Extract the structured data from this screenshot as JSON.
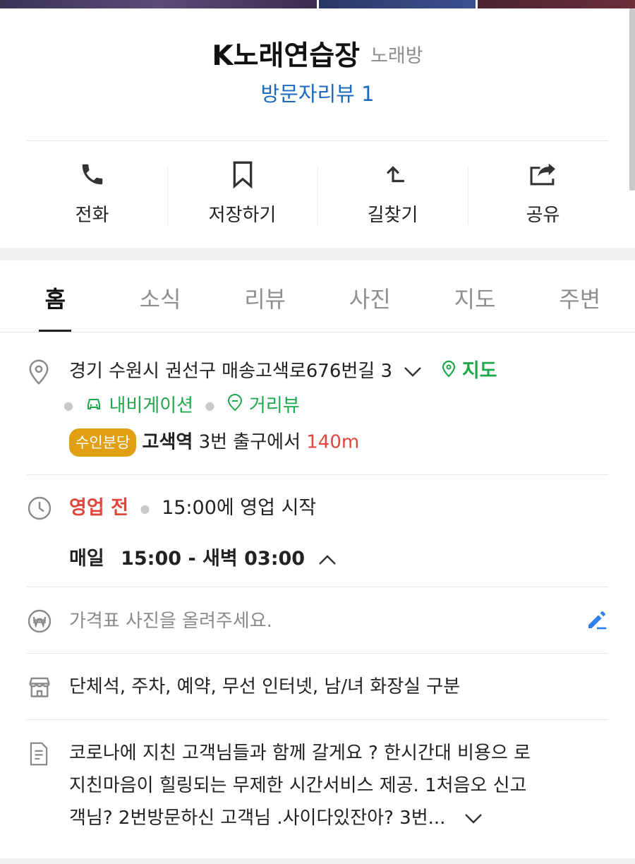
{
  "place": {
    "name": "K노래연습장",
    "category": "노래방",
    "reviews": "방문자리뷰 1"
  },
  "actions": [
    {
      "label": "전화",
      "icon": "phone-icon"
    },
    {
      "label": "저장하기",
      "icon": "bookmark-icon"
    },
    {
      "label": "길찾기",
      "icon": "directions-icon"
    },
    {
      "label": "공유",
      "icon": "share-icon"
    }
  ],
  "tabs": [
    "홈",
    "소식",
    "리뷰",
    "사진",
    "지도",
    "주변"
  ],
  "active_tab": "홈",
  "address": {
    "text": "경기 수원시 권선구 매송고색로676번길 3",
    "map_link": "지도",
    "navigation_link": "내비게이션",
    "streetview_link": "거리뷰"
  },
  "subway": {
    "line": "수인분당",
    "station": "고색역",
    "exit": "3번 출구에서",
    "distance": "140m"
  },
  "hours": {
    "status": "영업 전",
    "next": "15:00에 영업 시작",
    "days": "매일",
    "time": "15:00 - 새벽 03:00"
  },
  "price": {
    "placeholder": "가격표 사진을 올려주세요."
  },
  "amenities": "단체석, 주차, 예약, 무선 인터넷, 남/녀 화장실 구분",
  "description": {
    "line1": "코로나에 지친 고객님들과 함께 갈게요 ? 한시간대 비용으 로",
    "line2": "지친마음이 힐링되는 무제한 시간서비스 제공. 1처음오 신고",
    "line3": "객님? 2번방문하신 고객님 .사이다있잔아? 3번..."
  },
  "colors": {
    "link_blue": "#1a6bbd",
    "green": "#1fa84b",
    "red": "#e0473c",
    "badge_yellow": "#e1a012",
    "edit_blue": "#2f80ed"
  }
}
